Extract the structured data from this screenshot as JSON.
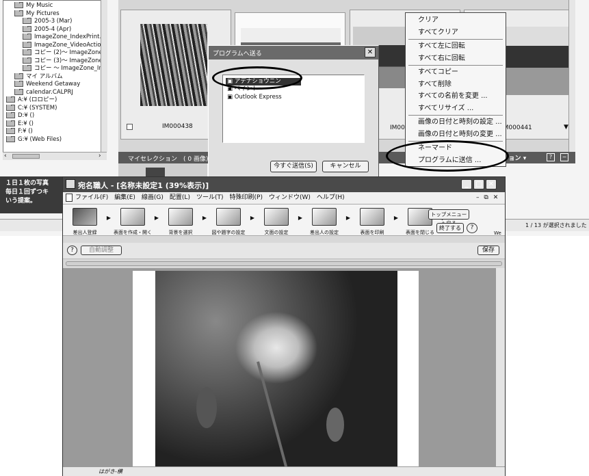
{
  "explorer": {
    "tree": [
      {
        "label": "My Music",
        "indent": 1
      },
      {
        "label": "My Pictures",
        "indent": 1
      },
      {
        "label": "2005-3 (Mar)",
        "indent": 2
      },
      {
        "label": "2005-4 (Apr)",
        "indent": 2
      },
      {
        "label": "ImageZone_IndexPrint.pl",
        "indent": 2
      },
      {
        "label": "ImageZone_VideoAction",
        "indent": 2
      },
      {
        "label": "コピー (2)～ ImageZone_",
        "indent": 2
      },
      {
        "label": "コピー (3)～ ImageZone_",
        "indent": 2
      },
      {
        "label": "コピー ～ ImageZone_Ind",
        "indent": 2
      },
      {
        "label": "マイ アルバム",
        "indent": 1
      },
      {
        "label": "Weekend Getaway",
        "indent": 1
      },
      {
        "label": "calendar.CALPRJ",
        "indent": 1
      },
      {
        "label": "A:¥ (ロロピー)",
        "indent": 0
      },
      {
        "label": "C:¥ (SYSTEM)",
        "indent": 0
      },
      {
        "label": "D:¥ ()",
        "indent": 0
      },
      {
        "label": "E:¥ ()",
        "indent": 0
      },
      {
        "label": "F:¥ ()",
        "indent": 0
      },
      {
        "label": "G:¥ (Web Files)",
        "indent": 0
      }
    ],
    "tip_text": [
      "１日１枚の写真",
      "毎日１回ずつキ",
      "いう提案。"
    ],
    "thumbs": [
      {
        "filename": "IM000438"
      },
      {
        "filename": ""
      },
      {
        "filename": "IM00"
      },
      {
        "filename": "IM000441"
      }
    ],
    "collection_label": "マイセレクション　( 0 画像)",
    "action_button": "アクション",
    "status_text": "1 / 13 が選択されました"
  },
  "send_dialog": {
    "title": "プログラムへ送る",
    "programs": [
      "アデナショウニン",
      "ペイント",
      "Outlook Express"
    ],
    "send_now": "今すぐ送信(S)",
    "cancel": "キャンセル"
  },
  "context_menu": {
    "items": [
      {
        "label": "クリア"
      },
      {
        "label": "すべてクリア"
      },
      {
        "sep": true
      },
      {
        "label": "すべて左に回転"
      },
      {
        "label": "すべて右に回転"
      },
      {
        "sep": true
      },
      {
        "label": "すべてコピー"
      },
      {
        "label": "すべて削除"
      },
      {
        "label": "すべての名前を変更 ..."
      },
      {
        "label": "すべてリサイズ ..."
      },
      {
        "sep": true
      },
      {
        "label": "画像の日付と時刻の設定 ..."
      },
      {
        "label": "画像の日付と時刻の変更 ..."
      },
      {
        "sep": true
      },
      {
        "label": "ネーマード"
      },
      {
        "label": "プログラムに送信 ..."
      }
    ]
  },
  "app": {
    "title": "宛名職人 - [名称未設定1 (39%表示)]",
    "menu": [
      "ファイル(F)",
      "編集(E)",
      "線画(G)",
      "配置(L)",
      "ツール(T)",
      "特殊印刷(P)",
      "ウィンドウ(W)",
      "ヘルプ(H)"
    ],
    "steps": [
      "差出人登録",
      "表面を作成・開く",
      "背景を選択",
      "図や題字の設定",
      "文面の設定",
      "差出人の設定",
      "表面を印刷",
      "表面を閉じる"
    ],
    "top_menu_button": "トップメニューへ戻る",
    "finish_button": "終了する",
    "help_glyph": "?",
    "auto_layout": "自動調整",
    "save_button": "保存",
    "status_label": "はがき-横",
    "side_cut_label": "We"
  }
}
